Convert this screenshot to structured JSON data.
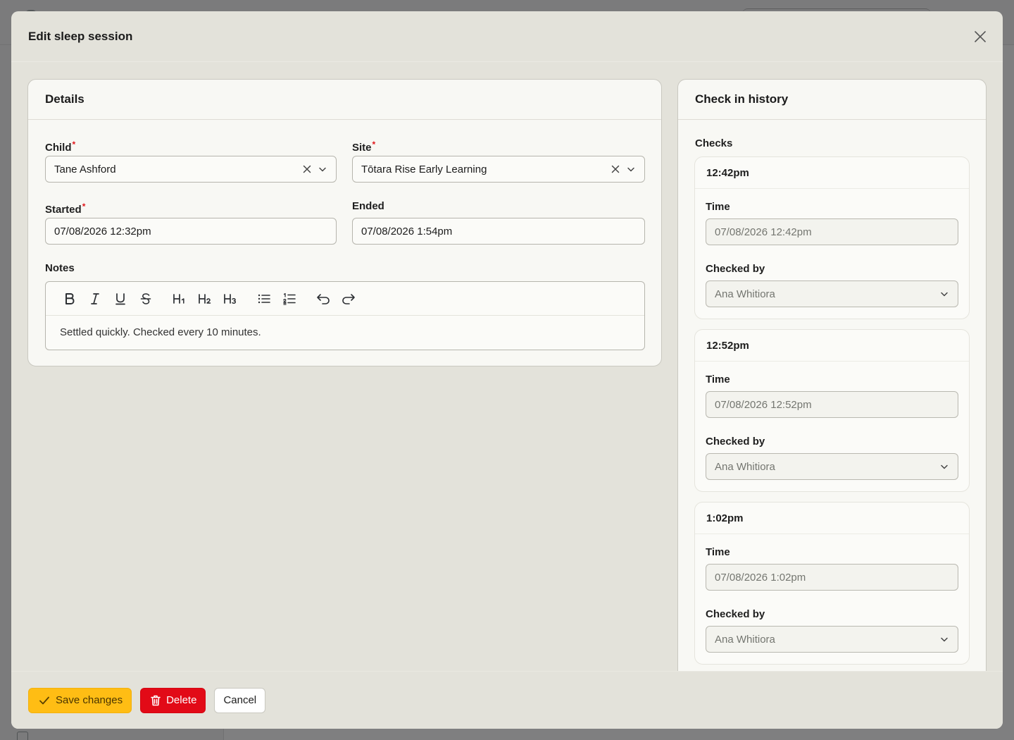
{
  "modal": {
    "title": "Edit sleep session"
  },
  "details": {
    "title": "Details",
    "child": {
      "label": "Child",
      "value": "Tane Ashford"
    },
    "site": {
      "label": "Site",
      "value": "Tōtara Rise Early Learning"
    },
    "started": {
      "label": "Started",
      "value": "07/08/2026 12:32pm"
    },
    "ended": {
      "label": "Ended",
      "value": "07/08/2026 1:54pm"
    },
    "notes": {
      "label": "Notes",
      "content": "Settled quickly. Checked every 10 minutes.",
      "toolbar": {
        "bold": "B",
        "italic": "I",
        "underline": "U",
        "strike": "S",
        "h1": "H1",
        "h2": "H2",
        "h3": "H3"
      }
    }
  },
  "history": {
    "title": "Check in history",
    "checks_label": "Checks",
    "checks": [
      {
        "heading": "12:42pm",
        "time_label": "Time",
        "time_value": "07/08/2026 12:42pm",
        "checked_by_label": "Checked by",
        "checked_by": "Ana Whitiora"
      },
      {
        "heading": "12:52pm",
        "time_label": "Time",
        "time_value": "07/08/2026 12:52pm",
        "checked_by_label": "Checked by",
        "checked_by": "Ana Whitiora"
      },
      {
        "heading": "1:02pm",
        "time_label": "Time",
        "time_value": "07/08/2026 1:02pm",
        "checked_by_label": "Checked by",
        "checked_by": "Ana Whitiora"
      }
    ]
  },
  "footer": {
    "save": "Save changes",
    "delete": "Delete",
    "cancel": "Cancel"
  },
  "colors": {
    "save": "#ffbd14",
    "delete": "#e20a17",
    "required": "#e0171b"
  }
}
